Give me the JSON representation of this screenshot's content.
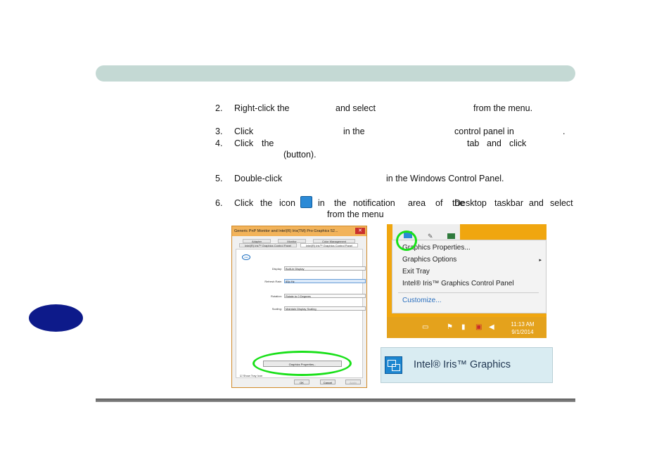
{
  "steps": [
    {
      "num": "2.",
      "parts": [
        "Right-click the",
        "and select",
        "from the menu."
      ]
    },
    {
      "num": "3.",
      "parts": [
        "Click",
        "in the",
        "control panel in",
        "."
      ]
    },
    {
      "num": "4.",
      "parts": [
        "Click",
        "the",
        "tab",
        "and",
        "click",
        "(button)."
      ]
    },
    {
      "num": "5.",
      "parts": [
        "Double-click",
        "in the Windows Control Panel."
      ]
    },
    {
      "num": "6.",
      "parts": [
        "Click",
        "the",
        "icon",
        "in",
        "the",
        "notification",
        "area",
        "of",
        "the",
        "Desktop",
        "taskbar",
        "and",
        "select",
        "from the menu"
      ]
    }
  ],
  "dialog": {
    "title": "Generic PnP Monitor and Intel(R) Iris(TM) Pro Graphics 52...",
    "close": "✕",
    "tabs_row1": [
      "Adapter",
      "Monitor",
      "Color Management"
    ],
    "tabs_row2": [
      "Intel(R) Iris™ Graphics Control Panel",
      "Intel(R) Iris™ Graphics Control Panel"
    ],
    "intel_logo": "intel",
    "rows": [
      {
        "label": "Display:",
        "value": "Built-in Display"
      },
      {
        "label": "Refresh Rate:",
        "value": "60p Hz"
      },
      {
        "label": "Rotation:",
        "value": "Rotate to 0 Degrees"
      },
      {
        "label": "Scaling:",
        "value": "Maintain Display Scaling"
      }
    ],
    "show_tray": "Show Tray Icon",
    "graphics_btn": "Graphics Properties...",
    "ok": "OK",
    "cancel": "Cancel",
    "apply": "Apply"
  },
  "tray_menu": {
    "items": [
      "Graphics Properties...",
      "Graphics Options",
      "Exit Tray",
      "Intel® Iris™ Graphics Control Panel"
    ],
    "customize": "Customize...",
    "submenu_arrow": "▸",
    "time": "11:13 AM",
    "date": "9/1/2014"
  },
  "banner": {
    "text": "Intel® Iris™ Graphics",
    "icon": "intel-graphics-icon"
  }
}
